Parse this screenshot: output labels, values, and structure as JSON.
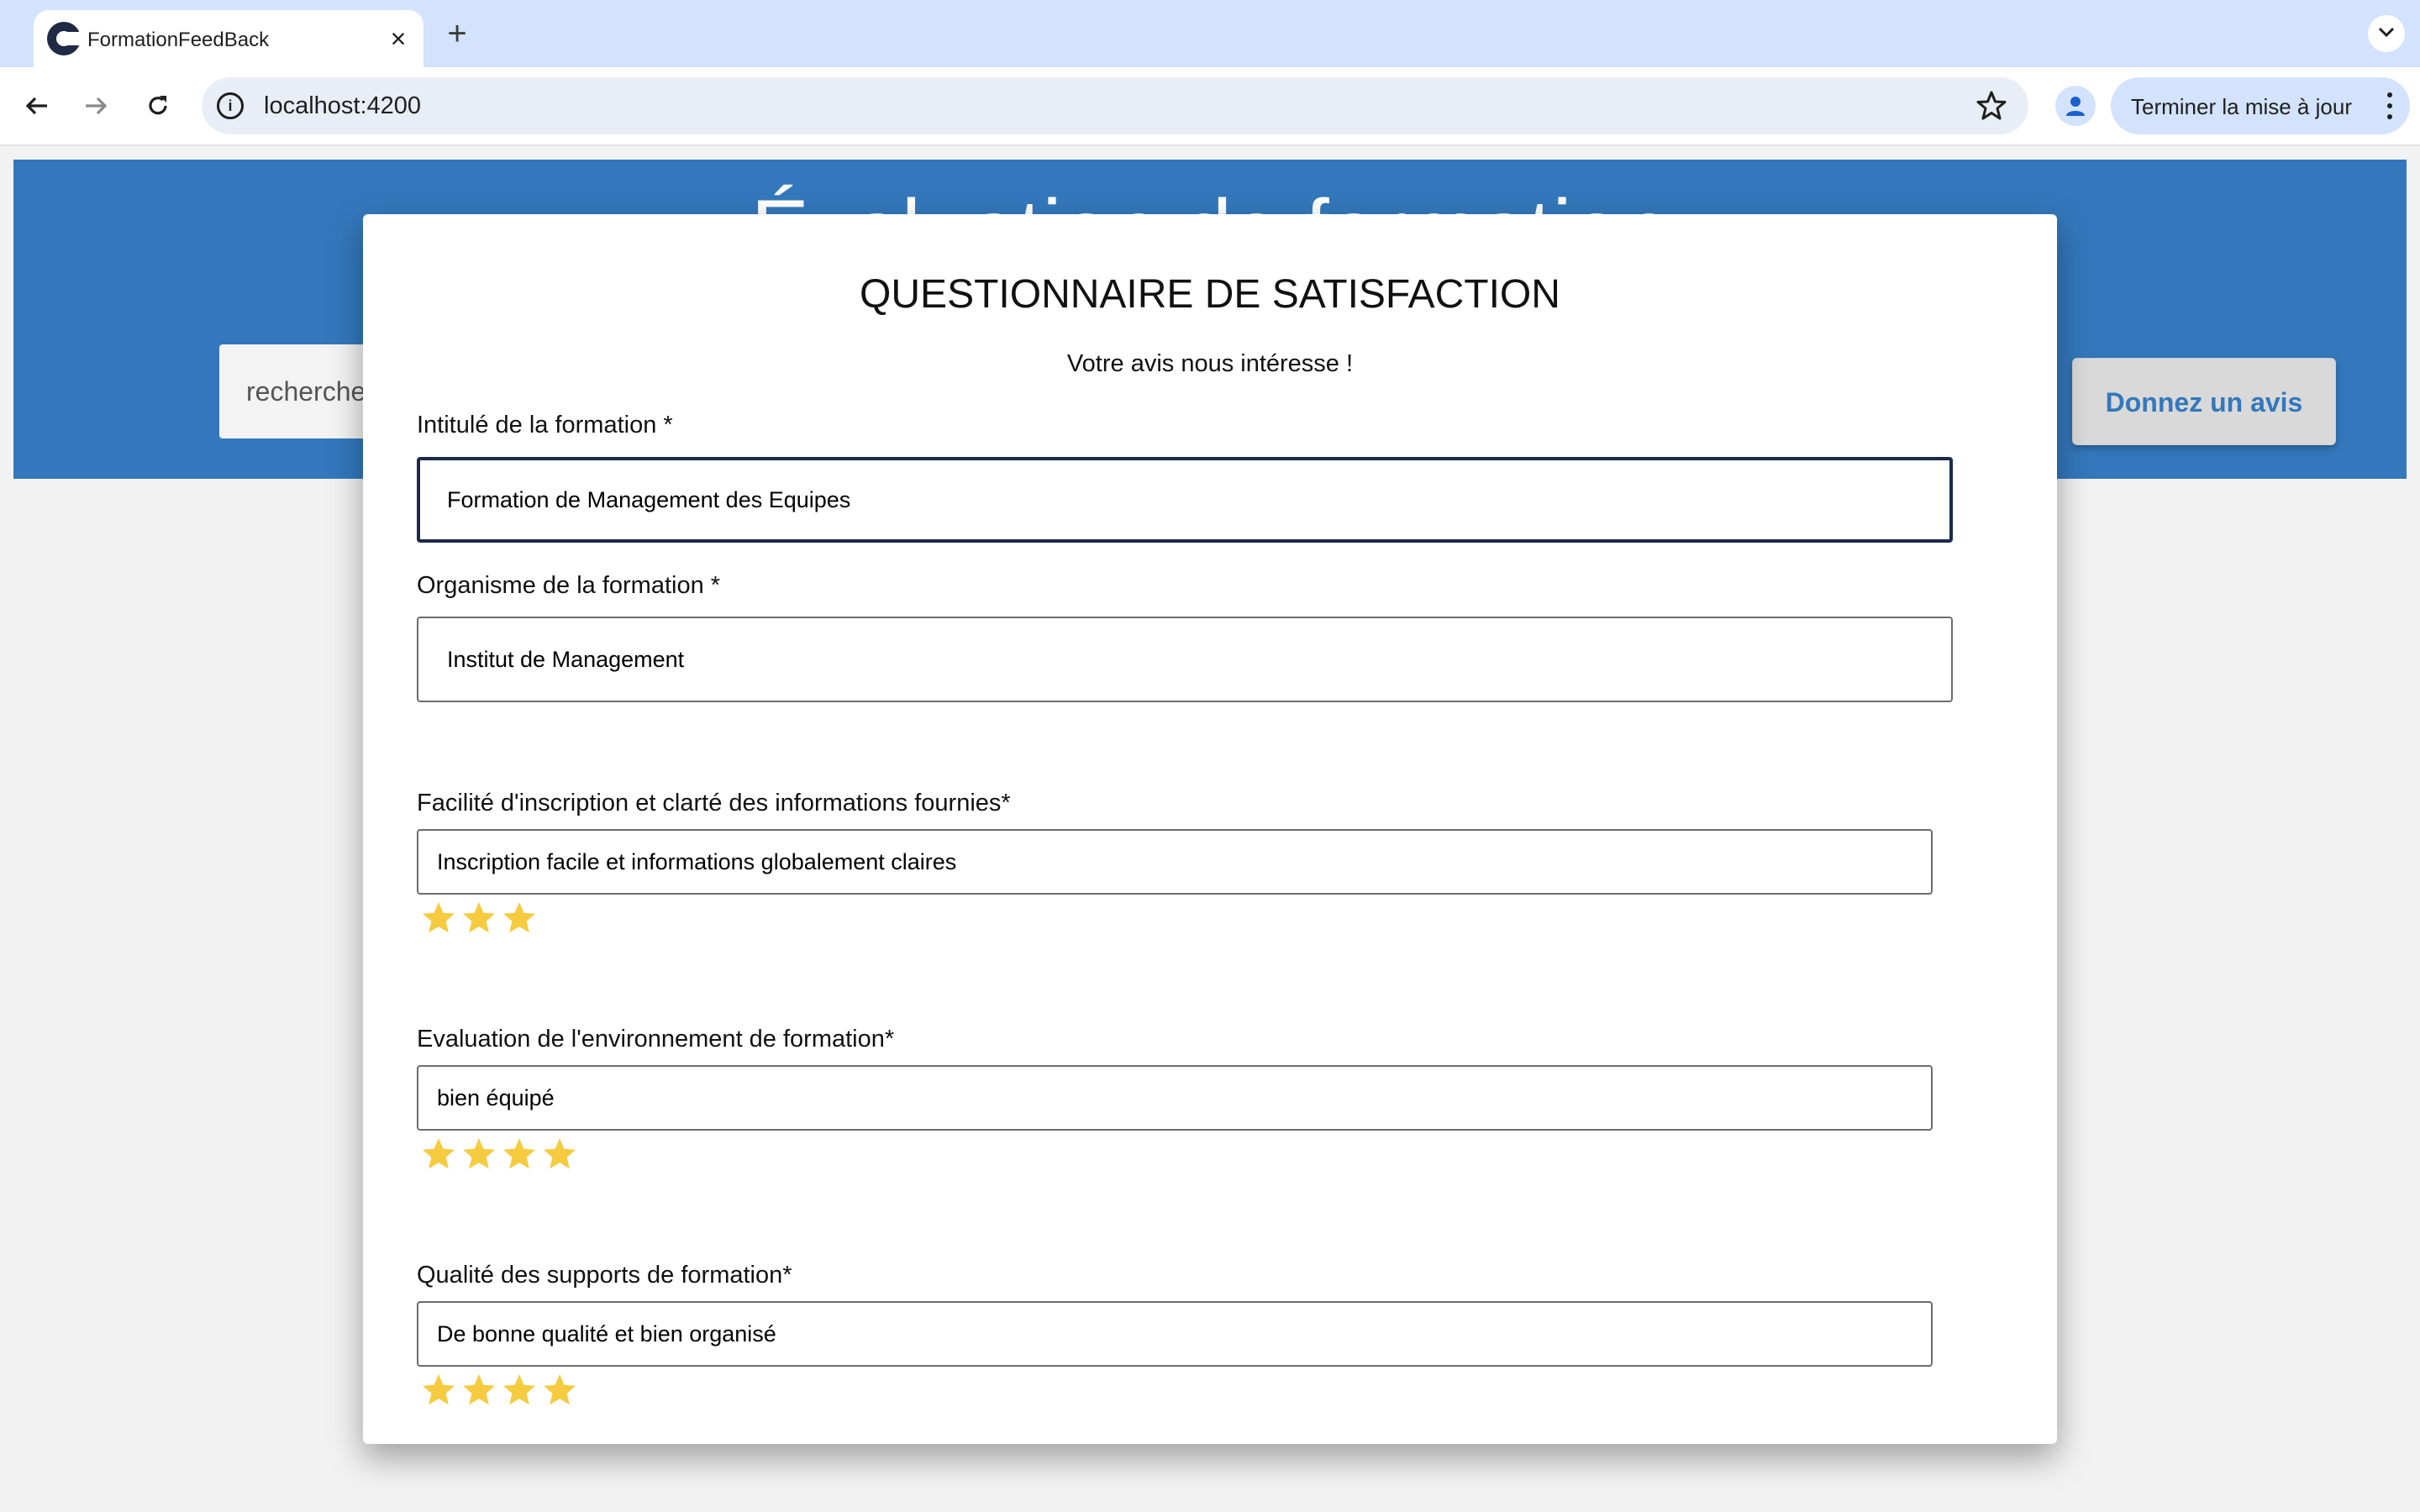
{
  "browser": {
    "tab_title": "FormationFeedBack",
    "close_glyph": "×",
    "new_tab_glyph": "+",
    "url": "localhost:4200",
    "info_glyph": "i",
    "update_label": "Terminer la mise à jour"
  },
  "page": {
    "hero_title": "Évaluation de formation",
    "search_placeholder": "recherche",
    "give_review_label": "Donnez un avis",
    "hero_color": "#3378bc"
  },
  "modal": {
    "title": "QUESTIONNAIRE DE SATISFACTION",
    "subtitle": "Votre avis nous intéresse !",
    "formation_title_label": "Intitulé de la formation *",
    "formation_title_value": "Formation de Management des Equipes",
    "organism_label": "Organisme de la formation *",
    "organism_value": "Institut de Management",
    "criteria": [
      {
        "label": "Facilité d'inscription et clarté des informations fournies*",
        "value": "Inscription facile et informations globalement claires",
        "rating": 3,
        "max_visible": 3
      },
      {
        "label": "Evaluation de l'environnement de formation*",
        "value": "bien équipé",
        "rating": 4,
        "max_visible": 4
      },
      {
        "label": "Qualité des supports de formation*",
        "value": "De bonne qualité et bien organisé",
        "rating": 4,
        "max_visible": 4
      }
    ],
    "star_color": "#f6cb3f"
  },
  "icons": [
    "app-favicon-icon",
    "close-icon",
    "plus-icon",
    "chevron-down-icon",
    "back-arrow-icon",
    "forward-arrow-icon",
    "reload-icon",
    "info-icon",
    "bookmark-star-icon",
    "profile-icon",
    "more-vert-icon",
    "star-icon"
  ]
}
